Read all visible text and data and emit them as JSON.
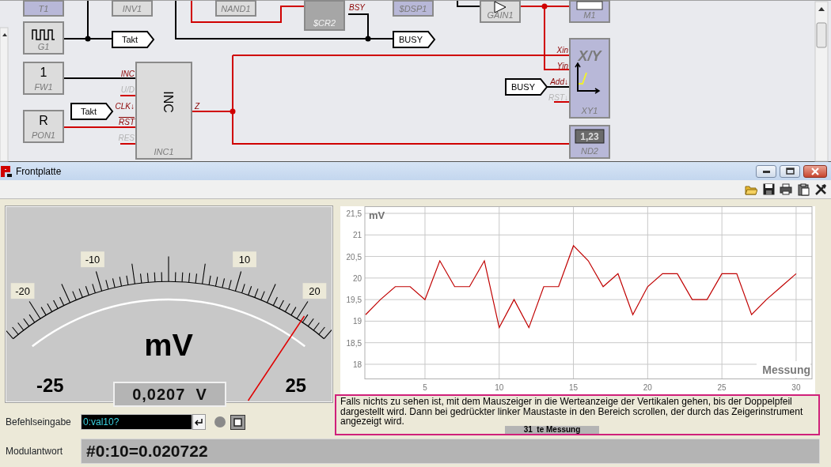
{
  "schematic": {
    "blocks": [
      {
        "kind": "plain",
        "name": "T1",
        "color": "#b8b8d8"
      },
      {
        "kind": "plain",
        "name": "INV1",
        "color": "#dcdcdc"
      },
      {
        "kind": "plain",
        "name": "NAND1",
        "color": "#dcdcdc"
      },
      {
        "kind": "plain",
        "name": "$CR2",
        "color": "#a6a6a6",
        "pins": [
          {
            "label": "BSY",
            "active": true,
            "inverted": false
          }
        ]
      },
      {
        "kind": "plain",
        "name": "$DSP1",
        "color": "#b8b8d8"
      },
      {
        "kind": "amplifier",
        "name": "GAIN1",
        "color": "#dcdcdc"
      },
      {
        "kind": "monitor",
        "name": "M1",
        "color": "#b8b8d8"
      },
      {
        "kind": "generator",
        "name": "G1",
        "color": "#dcdcdc"
      },
      {
        "kind": "text",
        "symbol": "1",
        "name": "FW1",
        "color": "#dcdcdc"
      },
      {
        "kind": "text",
        "symbol": "INC",
        "name": "INC1",
        "color": "#dcdcdc",
        "pins": [
          {
            "label": "INC",
            "active": true,
            "inverted": false
          },
          {
            "label": "U/D",
            "active": false,
            "inverted": false
          },
          {
            "label": "CLK↓",
            "active": true,
            "inverted": false
          },
          {
            "label": "RST",
            "active": true,
            "inverted": true
          },
          {
            "label": "RES",
            "active": false,
            "inverted": false
          },
          {
            "label": "Z",
            "active": true,
            "inverted": false
          }
        ]
      },
      {
        "kind": "text",
        "symbol": "R",
        "name": "PON1",
        "color": "#dcdcdc"
      },
      {
        "kind": "plotter",
        "symbol": "X/Y",
        "name": "XY1",
        "color": "#b8b8d8",
        "pins": [
          {
            "label": "Xin",
            "active": true,
            "inverted": false
          },
          {
            "label": "Yin",
            "active": true,
            "inverted": false
          },
          {
            "label": "Add↓",
            "active": true,
            "inverted": false
          },
          {
            "label": "RST↓",
            "active": false,
            "inverted": false
          }
        ]
      },
      {
        "kind": "display",
        "symbol": "1,23",
        "name": "ND2",
        "color": "#b8b8d8"
      }
    ],
    "tags": [
      {
        "text": "Takt"
      },
      {
        "text": "BUSY"
      },
      {
        "text": "Takt"
      },
      {
        "text": "BUSY"
      }
    ]
  },
  "window": {
    "title": "Frontplatte"
  },
  "meter": {
    "unit": "mV",
    "scale_labels": [
      "-20",
      "-10",
      "10",
      "20"
    ],
    "min_label": "-25",
    "max_label": "25",
    "level": 0.914,
    "reading": "0,0207  V"
  },
  "chart": {
    "chart_data": {
      "type": "line",
      "xlabel": "Messung",
      "ylabel": "mV",
      "x": [
        1,
        2,
        3,
        4,
        5,
        6,
        7,
        8,
        9,
        10,
        11,
        12,
        13,
        14,
        15,
        16,
        17,
        18,
        19,
        20,
        21,
        22,
        23,
        24,
        25,
        26,
        27,
        28,
        29,
        30
      ],
      "series": [
        {
          "color": "#c00000",
          "values": [
            19.15,
            19.5,
            19.8,
            19.8,
            19.5,
            20.4,
            19.8,
            19.8,
            20.4,
            18.85,
            19.5,
            18.85,
            19.8,
            19.8,
            20.75,
            20.4,
            19.8,
            20.1,
            19.15,
            19.8,
            20.1,
            20.1,
            19.5,
            19.5,
            20.1,
            20.1,
            19.15,
            19.5,
            19.8,
            20.1
          ]
        }
      ],
      "xlim": [
        0.95,
        31.07
      ],
      "ylim": [
        17.67,
        21.665
      ],
      "xticks": [
        5,
        10,
        15,
        20,
        25,
        30
      ],
      "grid": true,
      "yticks": [
        {
          "value": 18,
          "label": "18"
        },
        {
          "value": 18.5,
          "label": "18,5"
        },
        {
          "value": 19,
          "label": "19"
        },
        {
          "value": 19.5,
          "label": "19,5"
        },
        {
          "value": 20,
          "label": "20"
        },
        {
          "value": 20.5,
          "label": "20,5"
        },
        {
          "value": 21,
          "label": "21"
        },
        {
          "value": 21.5,
          "label": "21,5"
        }
      ]
    }
  },
  "hint": {
    "text": "Falls nichts zu sehen ist, mit dem Mauszeiger in die  Werteanzeige der Vertikalen gehen,  bis der Doppelpfeil dargestellt wird. Dann bei gedrückter linker Maustaste in den Bereich scrollen, der durch das Zeigerinstrument angezeigt wird.",
    "counter": "31  te Messung"
  },
  "command": {
    "label": "Befehlseingabe",
    "value": "0:val10?"
  },
  "response": {
    "label": "Modulantwort",
    "value": "#0:10=0.020722"
  }
}
